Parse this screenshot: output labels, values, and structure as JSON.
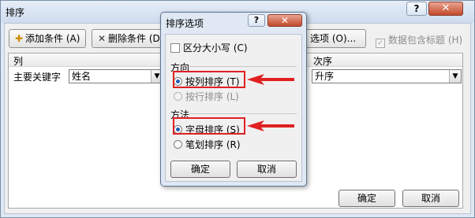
{
  "main": {
    "title": "排序",
    "help_label": "?",
    "close_label": "✕",
    "toolbar": {
      "add_label": "添加条件 (A)",
      "delete_label": "删除条件 (D)",
      "options_label": "选项 (O)...",
      "header_checkbox_label": "数据包含标题 (H)",
      "header_checkbox_checked": true
    },
    "grid": {
      "columns": [
        "列",
        "次序"
      ],
      "row": {
        "label": "主要关键字",
        "column_value": "姓名",
        "order_value": "升序"
      }
    },
    "ok_label": "确定",
    "cancel_label": "取消"
  },
  "options": {
    "title": "排序选项",
    "help_label": "?",
    "close_label": "✕",
    "case_label": "区分大小写 (C)",
    "case_checked": false,
    "direction": {
      "title": "方向",
      "items": [
        {
          "label": "按列排序 (T)",
          "selected": true,
          "enabled": true
        },
        {
          "label": "按行排序 (L)",
          "selected": false,
          "enabled": false
        }
      ]
    },
    "method": {
      "title": "方法",
      "items": [
        {
          "label": "字母排序 (S)",
          "selected": true,
          "enabled": true
        },
        {
          "label": "笔划排序 (R)",
          "selected": false,
          "enabled": true
        }
      ]
    },
    "ok_label": "确定",
    "cancel_label": "取消"
  },
  "colors": {
    "highlight": "#e02020",
    "accent": "#1f5fb5"
  }
}
